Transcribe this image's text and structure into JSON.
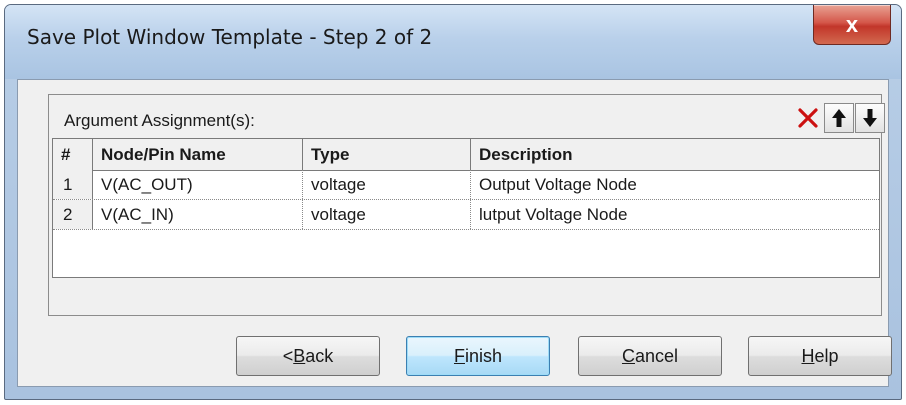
{
  "window": {
    "title": "Save Plot Window Template - Step 2 of 2",
    "close_glyph": "x"
  },
  "group": {
    "label": "Argument Assignment(s):",
    "tools": [
      {
        "name": "delete-icon",
        "color": "#cc1111"
      },
      {
        "name": "arrow-up-icon"
      },
      {
        "name": "arrow-down-icon"
      }
    ]
  },
  "table": {
    "headers": [
      "#",
      "Node/Pin Name",
      "Type",
      "Description"
    ],
    "rows": [
      {
        "num": "1",
        "node": "V(AC_OUT)",
        "type": "voltage",
        "desc": "Output Voltage Node"
      },
      {
        "num": "2",
        "node": "V(AC_IN)",
        "type": "voltage",
        "desc": "lutput Voltage Node"
      }
    ]
  },
  "buttons": {
    "back": {
      "prefix": "<",
      "mnemonic": "B",
      "rest": "ack"
    },
    "finish": {
      "mnemonic": "F",
      "rest": "inish"
    },
    "cancel": {
      "mnemonic": "C",
      "rest": "ancel"
    },
    "help": {
      "mnemonic": "H",
      "rest": "elp"
    }
  }
}
